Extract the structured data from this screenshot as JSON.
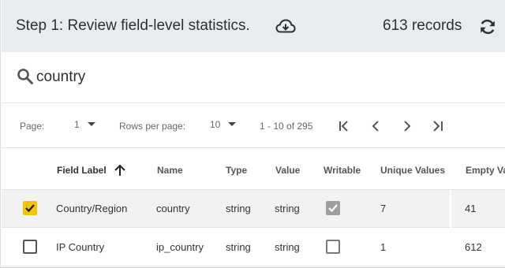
{
  "header": {
    "title": "Step 1: Review field-level statistics.",
    "record_count": "613 records",
    "download_icon": "cloud-download-icon",
    "refresh_icon": "refresh-icon"
  },
  "search": {
    "icon": "search-icon",
    "value": "country"
  },
  "pagination": {
    "page_label": "Page:",
    "page_value": "1",
    "rows_label": "Rows per page:",
    "rows_value": "10",
    "range": "1 - 10 of 295",
    "nav_icons": [
      "first-page-icon",
      "previous-page-icon",
      "next-page-icon",
      "last-page-icon"
    ]
  },
  "table": {
    "columns": [
      "Field Label",
      "Name",
      "Type",
      "Value",
      "Writable",
      "Unique Values",
      "Empty Va"
    ],
    "sort_column": "Field Label",
    "sort_direction": "ascending",
    "rows": [
      {
        "selected": true,
        "label": "Country/Region",
        "name": "country",
        "type": "string",
        "value": "string",
        "writable": true,
        "unique": "7",
        "empty": "41"
      },
      {
        "selected": false,
        "label": "IP Country",
        "name": "ip_country",
        "type": "string",
        "value": "string",
        "writable": false,
        "unique": "1",
        "empty": "612"
      }
    ]
  },
  "colors": {
    "header_bg": "#e9ecef",
    "selected_checkbox": "#f5c400",
    "selected_row_bg": "#f2f2f2"
  }
}
